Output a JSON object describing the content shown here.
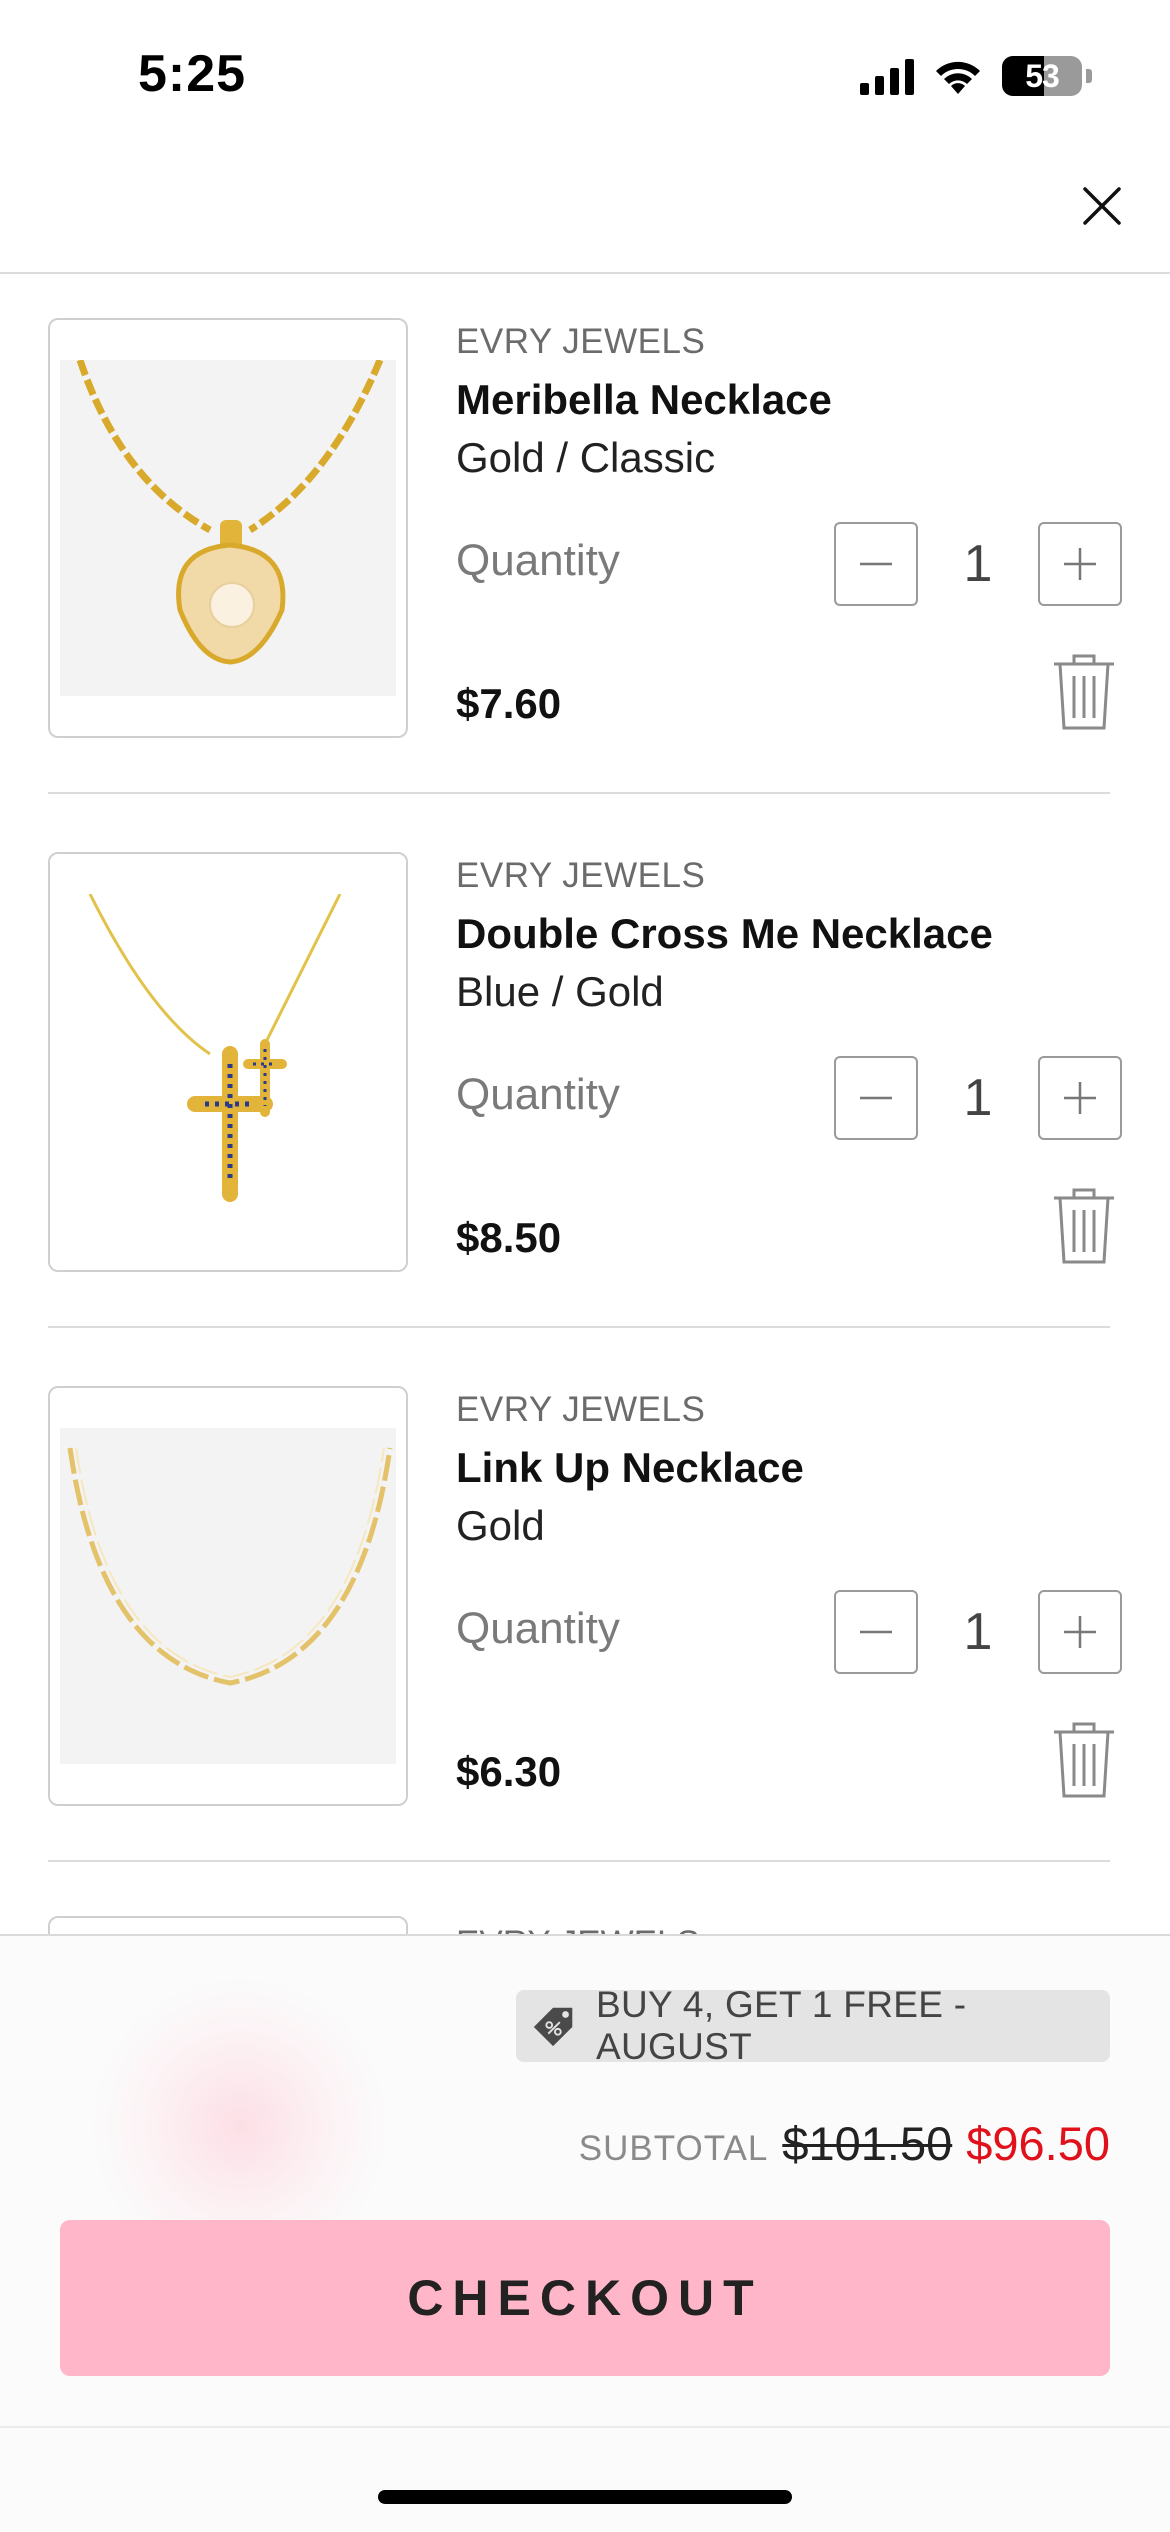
{
  "status_bar": {
    "time": "5:25",
    "battery": {
      "percent": 53,
      "label": "53"
    },
    "icons": [
      "cellular-signal-icon",
      "wifi-icon",
      "battery-icon"
    ]
  },
  "header": {
    "close_icon": "close-icon"
  },
  "cart": {
    "quantity_label": "Quantity",
    "items": [
      {
        "brand": "EVRY JEWELS",
        "name": "Meribella Necklace",
        "variant": "Gold / Classic",
        "quantity": "1",
        "price": "$7.60",
        "image_icon": "pearl-shell-necklace-image"
      },
      {
        "brand": "EVRY JEWELS",
        "name": "Double Cross Me Necklace",
        "variant": "Blue / Gold",
        "quantity": "1",
        "price": "$8.50",
        "image_icon": "double-cross-necklace-image"
      },
      {
        "brand": "EVRY JEWELS",
        "name": "Link Up Necklace",
        "variant": "Gold",
        "quantity": "1",
        "price": "$6.30",
        "image_icon": "link-chain-necklace-image"
      },
      {
        "brand": "EVRY JEWELS"
      }
    ]
  },
  "footer": {
    "promo": "BUY 4, GET 1 FREE - AUGUST",
    "subtotal_label": "SUBTOTAL",
    "subtotal_original": "$101.50",
    "subtotal_discounted": "$96.50",
    "checkout_label": "CHECKOUT"
  },
  "colors": {
    "accent_pink": "#ffb6c8",
    "sale_red": "#e0111b",
    "divider": "#dcdcdc",
    "gold": "#e2b43a"
  }
}
